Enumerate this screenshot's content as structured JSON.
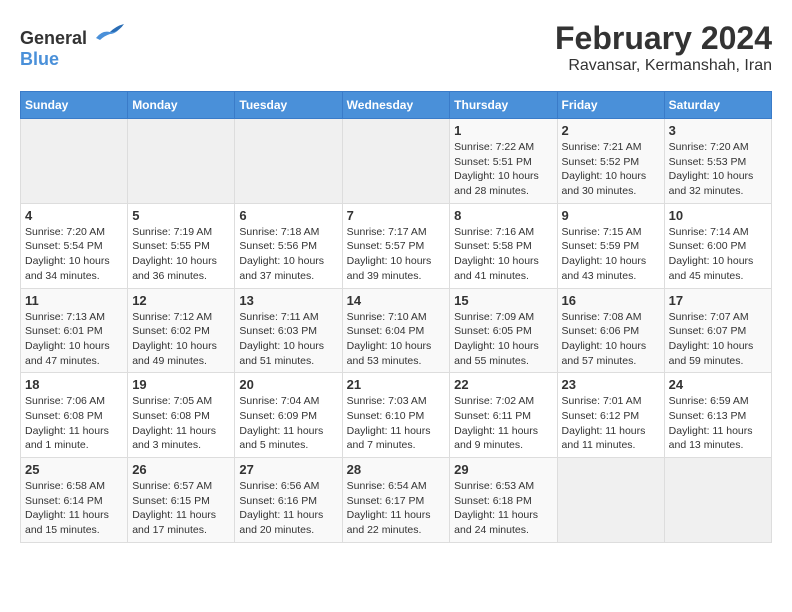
{
  "logo": {
    "general": "General",
    "blue": "Blue"
  },
  "title": {
    "month": "February 2024",
    "location": "Ravansar, Kermanshah, Iran"
  },
  "days_of_week": [
    "Sunday",
    "Monday",
    "Tuesday",
    "Wednesday",
    "Thursday",
    "Friday",
    "Saturday"
  ],
  "weeks": [
    [
      {
        "day": "",
        "info": ""
      },
      {
        "day": "",
        "info": ""
      },
      {
        "day": "",
        "info": ""
      },
      {
        "day": "",
        "info": ""
      },
      {
        "day": "1",
        "info": "Sunrise: 7:22 AM\nSunset: 5:51 PM\nDaylight: 10 hours and 28 minutes."
      },
      {
        "day": "2",
        "info": "Sunrise: 7:21 AM\nSunset: 5:52 PM\nDaylight: 10 hours and 30 minutes."
      },
      {
        "day": "3",
        "info": "Sunrise: 7:20 AM\nSunset: 5:53 PM\nDaylight: 10 hours and 32 minutes."
      }
    ],
    [
      {
        "day": "4",
        "info": "Sunrise: 7:20 AM\nSunset: 5:54 PM\nDaylight: 10 hours and 34 minutes."
      },
      {
        "day": "5",
        "info": "Sunrise: 7:19 AM\nSunset: 5:55 PM\nDaylight: 10 hours and 36 minutes."
      },
      {
        "day": "6",
        "info": "Sunrise: 7:18 AM\nSunset: 5:56 PM\nDaylight: 10 hours and 37 minutes."
      },
      {
        "day": "7",
        "info": "Sunrise: 7:17 AM\nSunset: 5:57 PM\nDaylight: 10 hours and 39 minutes."
      },
      {
        "day": "8",
        "info": "Sunrise: 7:16 AM\nSunset: 5:58 PM\nDaylight: 10 hours and 41 minutes."
      },
      {
        "day": "9",
        "info": "Sunrise: 7:15 AM\nSunset: 5:59 PM\nDaylight: 10 hours and 43 minutes."
      },
      {
        "day": "10",
        "info": "Sunrise: 7:14 AM\nSunset: 6:00 PM\nDaylight: 10 hours and 45 minutes."
      }
    ],
    [
      {
        "day": "11",
        "info": "Sunrise: 7:13 AM\nSunset: 6:01 PM\nDaylight: 10 hours and 47 minutes."
      },
      {
        "day": "12",
        "info": "Sunrise: 7:12 AM\nSunset: 6:02 PM\nDaylight: 10 hours and 49 minutes."
      },
      {
        "day": "13",
        "info": "Sunrise: 7:11 AM\nSunset: 6:03 PM\nDaylight: 10 hours and 51 minutes."
      },
      {
        "day": "14",
        "info": "Sunrise: 7:10 AM\nSunset: 6:04 PM\nDaylight: 10 hours and 53 minutes."
      },
      {
        "day": "15",
        "info": "Sunrise: 7:09 AM\nSunset: 6:05 PM\nDaylight: 10 hours and 55 minutes."
      },
      {
        "day": "16",
        "info": "Sunrise: 7:08 AM\nSunset: 6:06 PM\nDaylight: 10 hours and 57 minutes."
      },
      {
        "day": "17",
        "info": "Sunrise: 7:07 AM\nSunset: 6:07 PM\nDaylight: 10 hours and 59 minutes."
      }
    ],
    [
      {
        "day": "18",
        "info": "Sunrise: 7:06 AM\nSunset: 6:08 PM\nDaylight: 11 hours and 1 minute."
      },
      {
        "day": "19",
        "info": "Sunrise: 7:05 AM\nSunset: 6:08 PM\nDaylight: 11 hours and 3 minutes."
      },
      {
        "day": "20",
        "info": "Sunrise: 7:04 AM\nSunset: 6:09 PM\nDaylight: 11 hours and 5 minutes."
      },
      {
        "day": "21",
        "info": "Sunrise: 7:03 AM\nSunset: 6:10 PM\nDaylight: 11 hours and 7 minutes."
      },
      {
        "day": "22",
        "info": "Sunrise: 7:02 AM\nSunset: 6:11 PM\nDaylight: 11 hours and 9 minutes."
      },
      {
        "day": "23",
        "info": "Sunrise: 7:01 AM\nSunset: 6:12 PM\nDaylight: 11 hours and 11 minutes."
      },
      {
        "day": "24",
        "info": "Sunrise: 6:59 AM\nSunset: 6:13 PM\nDaylight: 11 hours and 13 minutes."
      }
    ],
    [
      {
        "day": "25",
        "info": "Sunrise: 6:58 AM\nSunset: 6:14 PM\nDaylight: 11 hours and 15 minutes."
      },
      {
        "day": "26",
        "info": "Sunrise: 6:57 AM\nSunset: 6:15 PM\nDaylight: 11 hours and 17 minutes."
      },
      {
        "day": "27",
        "info": "Sunrise: 6:56 AM\nSunset: 6:16 PM\nDaylight: 11 hours and 20 minutes."
      },
      {
        "day": "28",
        "info": "Sunrise: 6:54 AM\nSunset: 6:17 PM\nDaylight: 11 hours and 22 minutes."
      },
      {
        "day": "29",
        "info": "Sunrise: 6:53 AM\nSunset: 6:18 PM\nDaylight: 11 hours and 24 minutes."
      },
      {
        "day": "",
        "info": ""
      },
      {
        "day": "",
        "info": ""
      }
    ]
  ]
}
